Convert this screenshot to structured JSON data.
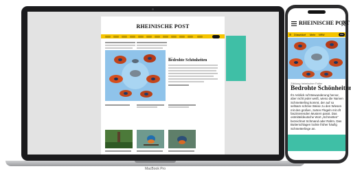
{
  "laptop": {
    "brand_label": "MacBook Pro",
    "masthead": "RHEINISCHE POST",
    "featured": {
      "headline": "Bedrohte Schönheiten"
    }
  },
  "phone": {
    "masthead": "RHEINISCHE POST",
    "nav": [
      "Düsseldorf",
      "Mehr",
      "NRW"
    ],
    "nav_button": "Abo",
    "kicker": "Zählung heimischer Falter",
    "headline": "Bedrohte Schönheiten",
    "body": "Ihr Anblick ruft Bewunderung hervor, aber nicht jeder weiß, wieso die Namen Schmetterling kommt, der auf so seltsam schöne Weise zu den Wiesen mit den großen, zarten Flügeln mit oft faszinierenden Mustern passt. Das ostmitteldeutsche Wort „Schmetten“ bezeichnet Schmand oder Rahm. Das Butterschlagen lockte früher häufig Schmetterlinge an."
  },
  "colors": {
    "accent_yellow": "#f5c400",
    "teal": "#3fbfa6",
    "device_dark": "#1b1b1d"
  },
  "icons": {
    "butterfly": "butterfly-image",
    "kingfisher": "kingfisher-image",
    "tree": "tree-image",
    "menu": "hamburger-icon",
    "user": "user-icon"
  }
}
